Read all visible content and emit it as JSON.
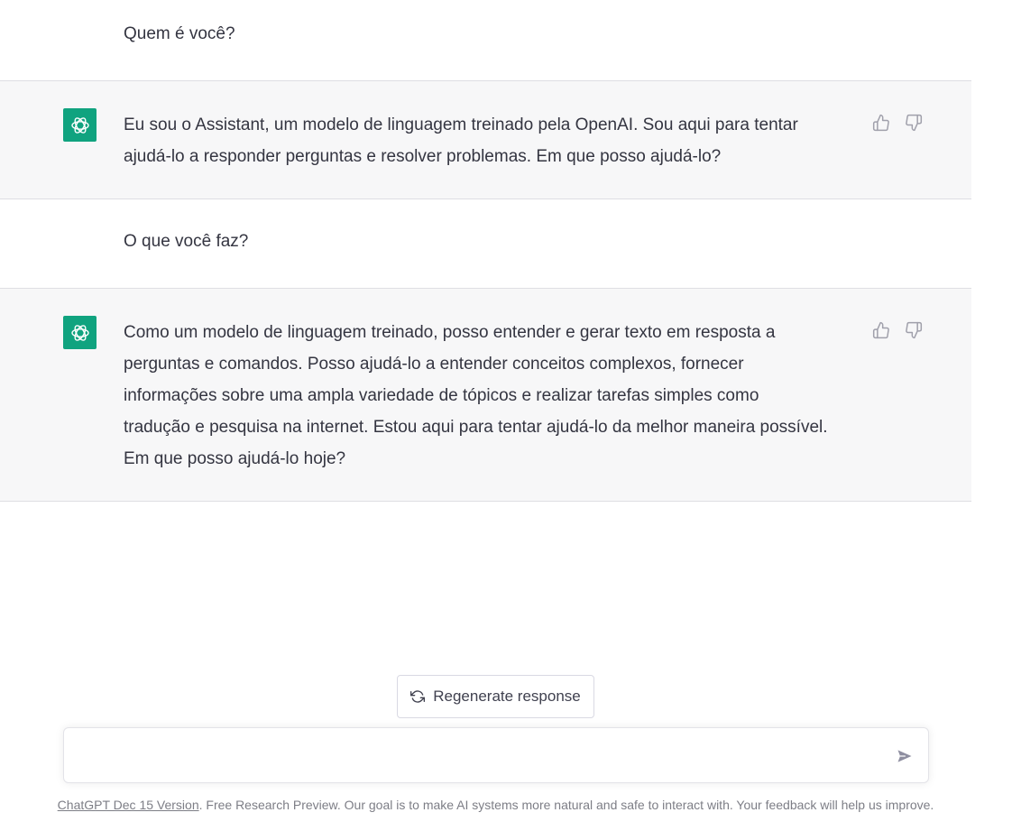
{
  "conversation": {
    "messages": [
      {
        "role": "user",
        "text": "Quem é você?"
      },
      {
        "role": "assistant",
        "lines": [
          "Eu sou o Assistant, um modelo de linguagem treinado pela OpenAI. Sou aqui para tentar",
          "ajudá-lo a responder perguntas e resolver problemas. Em que posso ajudá-lo?"
        ]
      },
      {
        "role": "user",
        "text": "O que você faz?"
      },
      {
        "role": "assistant",
        "lines": [
          "Como um modelo de linguagem treinado, posso entender e gerar texto em resposta a",
          "perguntas e comandos. Posso ajudá-lo a entender conceitos complexos, fornecer",
          "informações sobre uma ampla variedade de tópicos e realizar tarefas simples como",
          "tradução e pesquisa na internet. Estou aqui para tentar ajudá-lo da melhor maneira possível.",
          "Em que posso ajudá-lo hoje?"
        ]
      }
    ]
  },
  "icons": {
    "avatar": "openai-logo-icon",
    "like": "thumbs-up-icon",
    "dislike": "thumbs-down-icon",
    "regenerate": "refresh-icon",
    "send": "send-icon"
  },
  "colors": {
    "accent": "#10a37f",
    "assistant_bg": "#f7f7f8"
  },
  "regenerate": {
    "label": "Regenerate response"
  },
  "composer": {
    "value": "",
    "placeholder": ""
  },
  "footer": {
    "link": "ChatGPT Dec 15 Version",
    "text": ". Free Research Preview. Our goal is to make AI systems more natural and safe to interact with. Your feedback will help us improve."
  }
}
